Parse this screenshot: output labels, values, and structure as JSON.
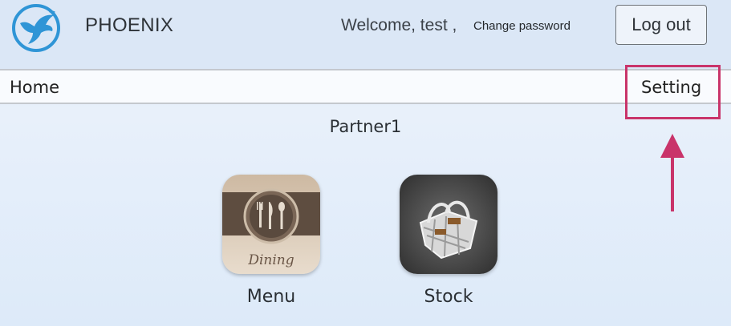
{
  "header": {
    "brand": "PHOENIX",
    "welcome": "Welcome, test ,",
    "change_password": "Change password",
    "logout": "Log out"
  },
  "nav": {
    "home": "Home",
    "setting": "Setting"
  },
  "main": {
    "partner_name": "Partner1",
    "apps": [
      {
        "label": "Menu",
        "icon": "dining-icon",
        "icon_text": "Dining"
      },
      {
        "label": "Stock",
        "icon": "basket-icon"
      }
    ]
  },
  "colors": {
    "highlight": "#c9346a",
    "logo_blue": "#2f95d6"
  }
}
